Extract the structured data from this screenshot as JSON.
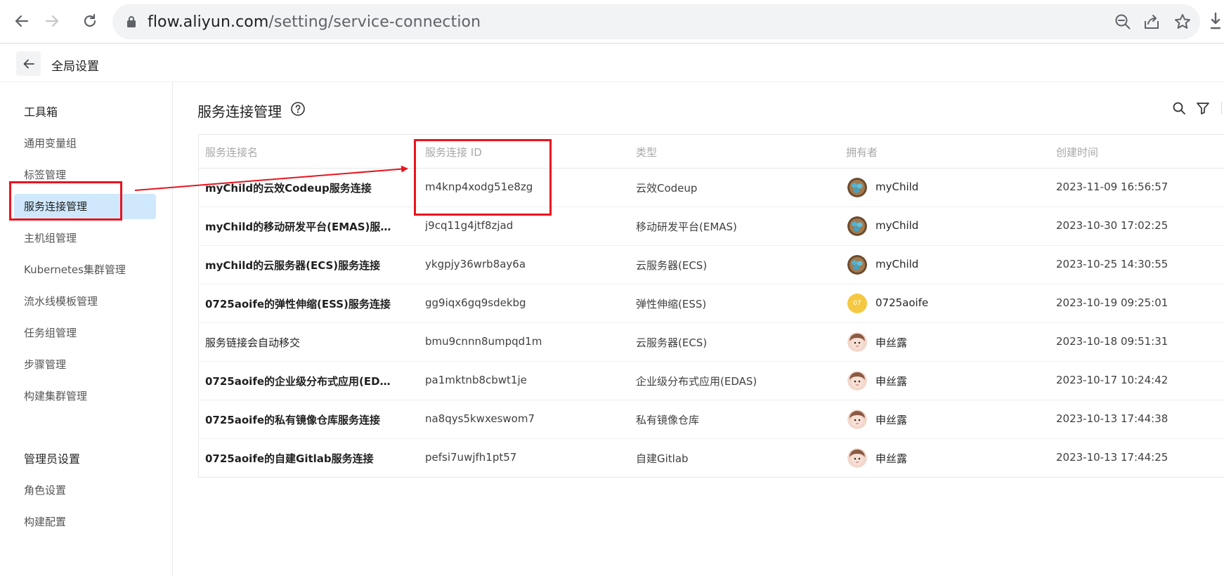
{
  "browser": {
    "url_host": "flow.aliyun.com",
    "url_path": "/setting/service-connection"
  },
  "header": {
    "title": "全局设置"
  },
  "sidebar": {
    "group1_title": "工具箱",
    "items": [
      {
        "label": "通用变量组"
      },
      {
        "label": "标签管理"
      },
      {
        "label": "服务连接管理"
      },
      {
        "label": "主机组管理"
      },
      {
        "label": "Kubernetes集群管理"
      },
      {
        "label": "流水线模板管理"
      },
      {
        "label": "任务组管理"
      },
      {
        "label": "步骤管理"
      },
      {
        "label": "构建集群管理"
      }
    ],
    "group2_title": "管理员设置",
    "admin_items": [
      {
        "label": "角色设置"
      },
      {
        "label": "构建配置"
      }
    ]
  },
  "main": {
    "title": "服务连接管理",
    "columns": [
      "服务连接名",
      "服务连接 ID",
      "类型",
      "拥有者",
      "创建时间"
    ],
    "rows": [
      {
        "name": "myChild的云效Codeup服务连接",
        "id": "m4knp4xodg51e8zg",
        "type": "云效Codeup",
        "owner": "myChild",
        "created": "2023-11-09 16:56:57"
      },
      {
        "name": "myChild的移动研发平台(EMAS)服务...",
        "id": "j9cq11g4jtf8zjad",
        "type": "移动研发平台(EMAS)",
        "owner": "myChild",
        "created": "2023-10-30 17:02:25"
      },
      {
        "name": "myChild的云服务器(ECS)服务连接",
        "id": "ykgpjy36wrb8ay6a",
        "type": "云服务器(ECS)",
        "owner": "myChild",
        "created": "2023-10-25 14:30:55"
      },
      {
        "name": "0725aoife的弹性伸缩(ESS)服务连接",
        "id": "gg9iqx6gq9sdekbg",
        "type": "弹性伸缩(ESS)",
        "owner": "0725aoife",
        "owner_initials": "07",
        "created": "2023-10-19 09:25:01"
      },
      {
        "name": "服务链接会自动移交",
        "id": "bmu9cnnn8umpqd1m",
        "type": "云服务器(ECS)",
        "owner": "申丝露",
        "created": "2023-10-18 09:51:31"
      },
      {
        "name": "0725aoife的企业级分布式应用(EDA...",
        "id": "pa1mktnb8cbwt1je",
        "type": "企业级分布式应用(EDAS)",
        "owner": "申丝露",
        "created": "2023-10-17 10:24:42"
      },
      {
        "name": "0725aoife的私有镜像仓库服务连接",
        "id": "na8qys5kwxeswom7",
        "type": "私有镜像仓库",
        "owner": "申丝露",
        "created": "2023-10-13 17:44:38"
      },
      {
        "name": "0725aoife的自建Gitlab服务连接",
        "id": "pefsi7uwjfh1pt57",
        "type": "自建Gitlab",
        "owner": "申丝露",
        "created": "2023-10-13 17:44:25"
      }
    ]
  },
  "colors": {
    "highlight_red": "#e8141e",
    "active_nav_bg": "#cfe8fb",
    "initials_avatar": "#f5c842"
  }
}
